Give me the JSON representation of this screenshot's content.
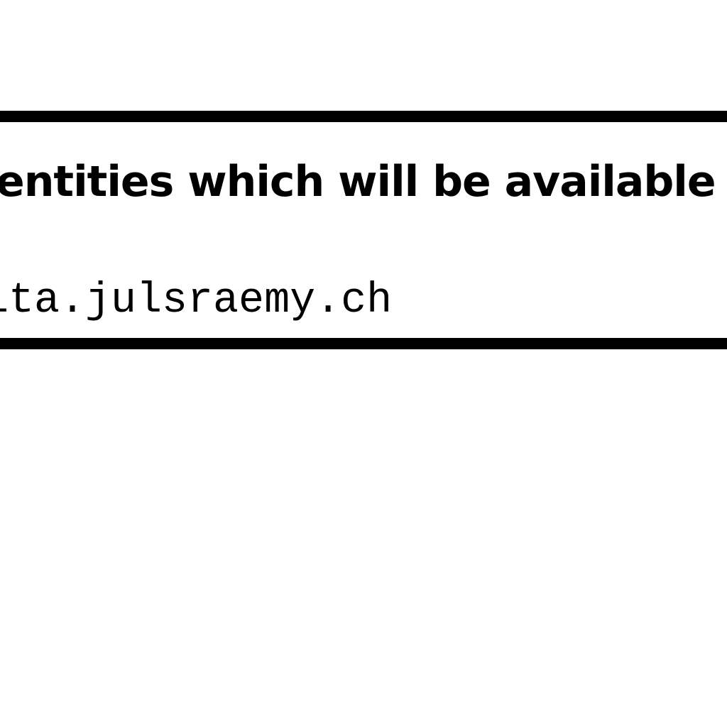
{
  "banner": {
    "heading": "entities which will be available at",
    "url": "ita.julsraemy.ch"
  }
}
